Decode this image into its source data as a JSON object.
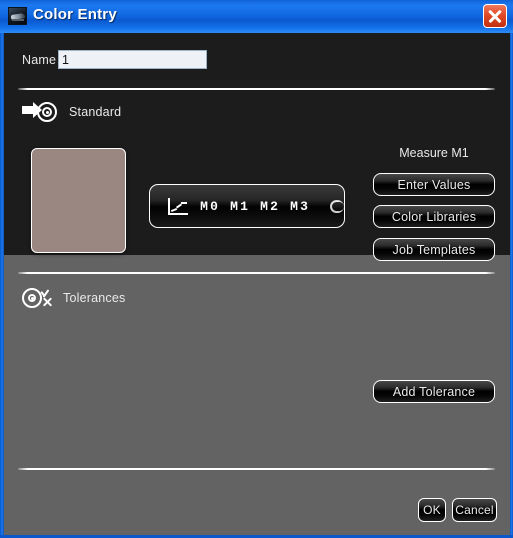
{
  "window": {
    "title": "Color Entry",
    "icon": "photo-thumbnail-icon",
    "close_label": "",
    "accent_color": "#1d79f0",
    "body_dark_color": "#1c1c1c",
    "body_gray_color": "#636363"
  },
  "name_field": {
    "label": "Name",
    "value": "1",
    "placeholder": ""
  },
  "standard_section": {
    "label": "Standard",
    "icon": "arrow-to-target-icon"
  },
  "color_swatch": {
    "color": "#9a8782"
  },
  "measurement_bar": {
    "chart_icon": "line-chart-icon",
    "measurements": "M0 M1 M2 M3",
    "toggle": {
      "state": "off",
      "knob_color": "#111111",
      "track_color": "#e6e6e6"
    }
  },
  "measure_panel": {
    "title": "Measure M1",
    "buttons": [
      {
        "label": "Enter Values"
      },
      {
        "label": "Color Libraries"
      },
      {
        "label": "Job Templates"
      }
    ]
  },
  "tolerances_section": {
    "label": "Tolerances",
    "icon": "target-check-x-icon",
    "add_button": "Add Tolerance"
  },
  "footer": {
    "ok_label": "OK",
    "cancel_label": "Cancel"
  }
}
